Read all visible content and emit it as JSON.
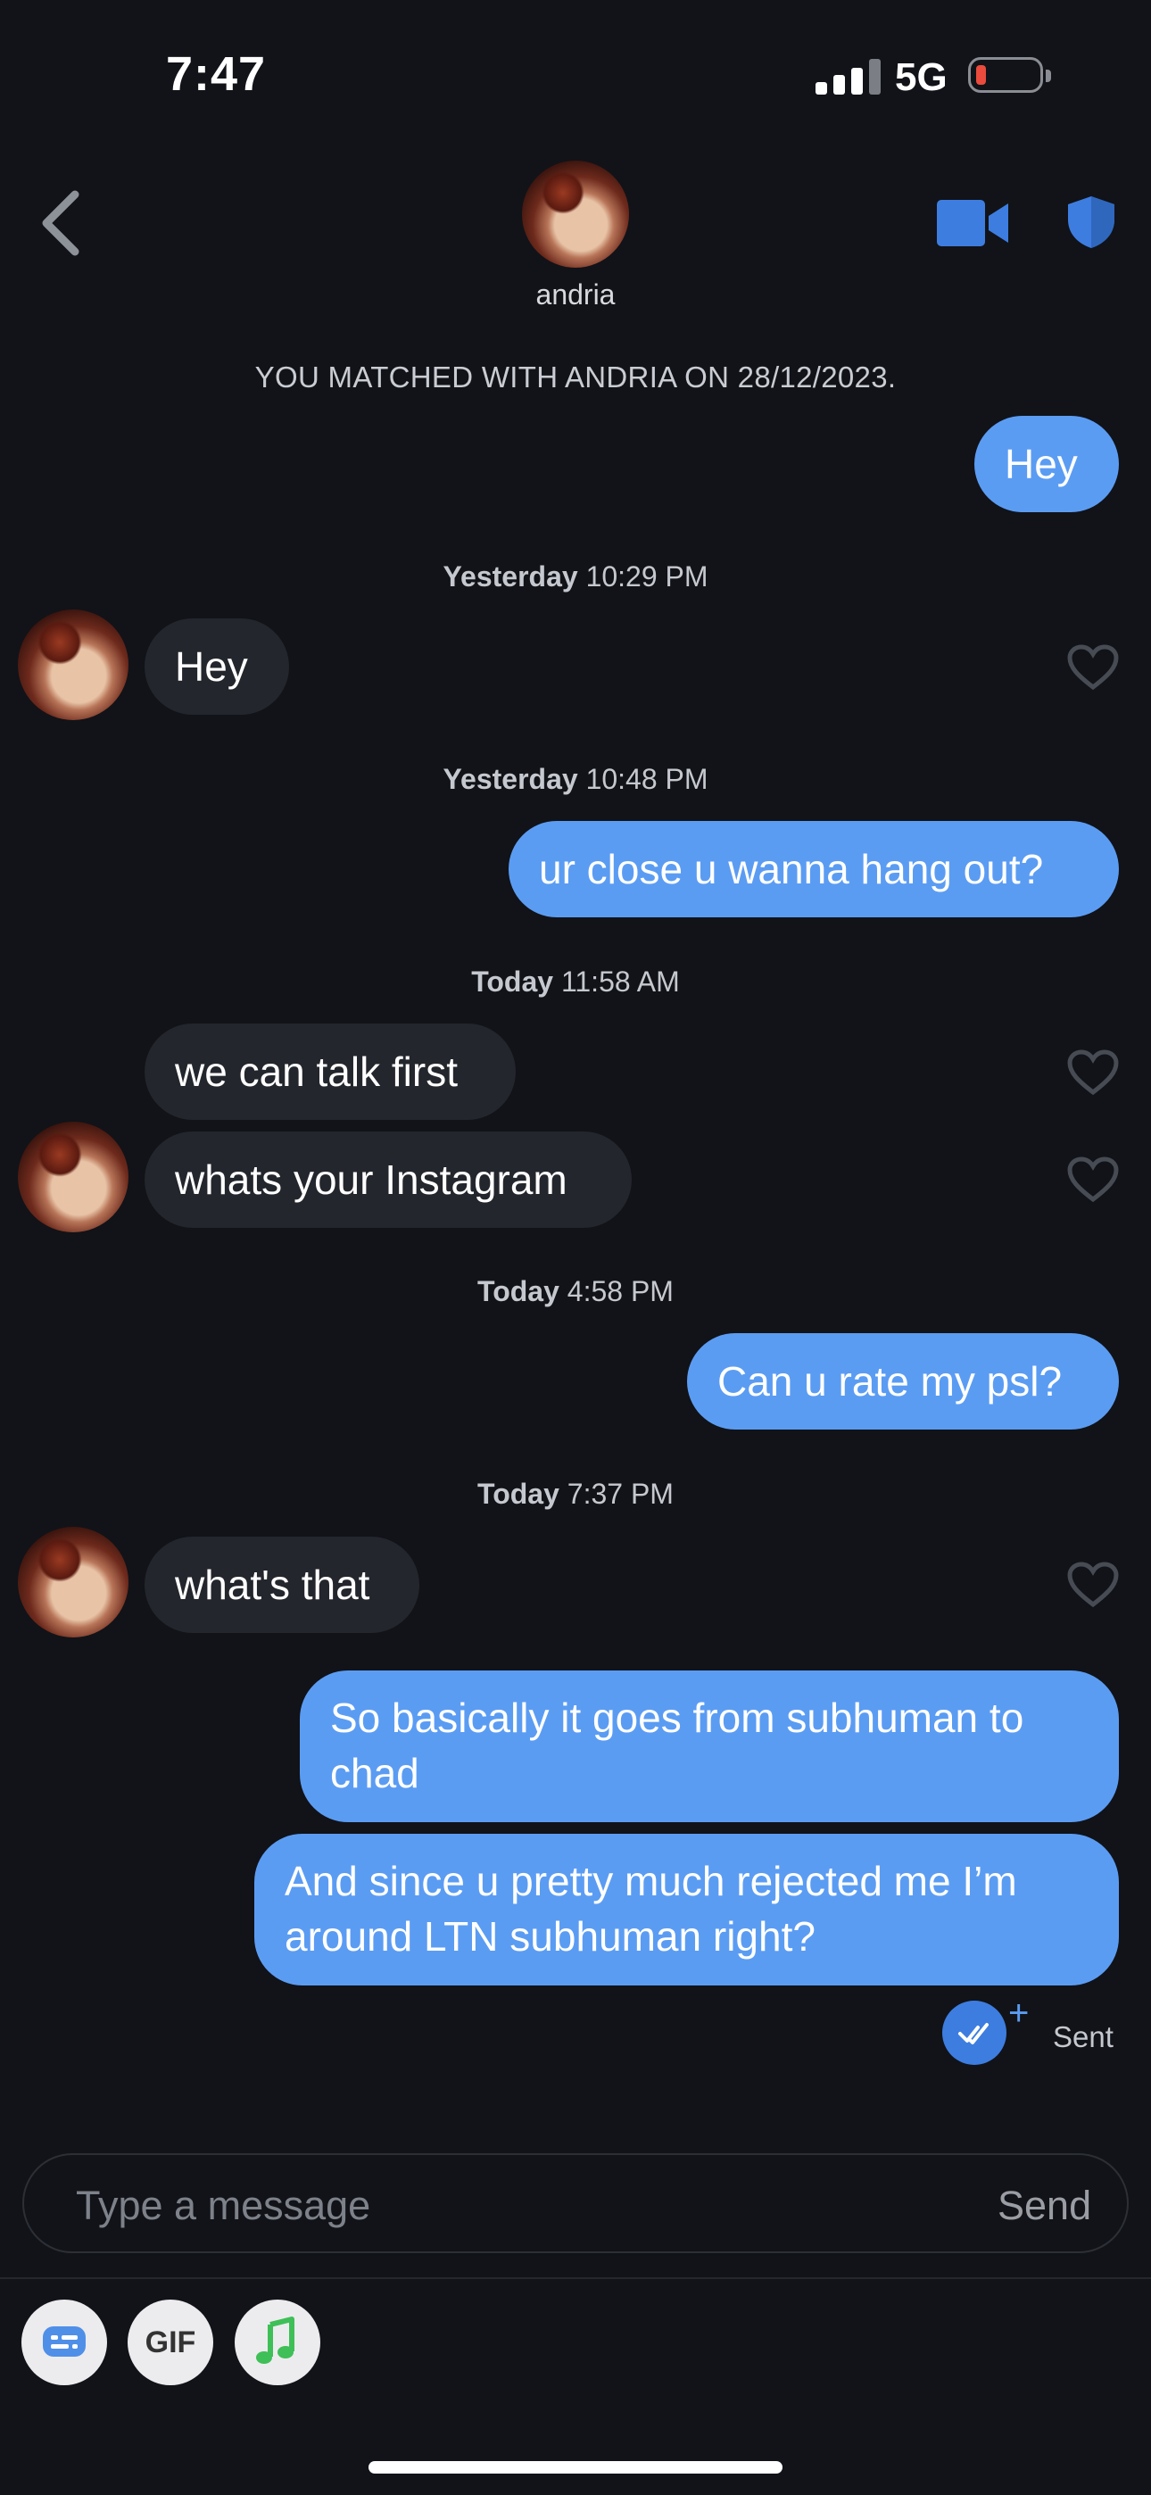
{
  "status_bar": {
    "time": "7:47",
    "network": "5G"
  },
  "header": {
    "name": "andria"
  },
  "match_notice": "YOU MATCHED WITH ANDRIA ON 28/12/2023.",
  "messages": {
    "m1": "Hey",
    "ts1_day": "Yesterday",
    "ts1_time": "10:29 PM",
    "m2": "Hey",
    "ts2_day": "Yesterday",
    "ts2_time": "10:48 PM",
    "m3": "ur close u wanna hang out?",
    "ts3_day": "Today",
    "ts3_time": "11:58 AM",
    "m4": "we can talk first",
    "m5": "whats your Instagram",
    "ts4_day": "Today",
    "ts4_time": "4:58 PM",
    "m6": "Can u rate my psl?",
    "ts5_day": "Today",
    "ts5_time": "7:37 PM",
    "m7": "what's that",
    "m8": "So basically it goes from subhuman to chad",
    "m9": "And since u pretty much rejected me I’m around LTN subhuman right?"
  },
  "receipt": {
    "plus": "+",
    "status": "Sent"
  },
  "composer": {
    "placeholder": "Type a message",
    "send_label": "Send"
  },
  "toolbar": {
    "gif_label": "GIF"
  },
  "colors": {
    "accent": "#5b9cf3",
    "incoming": "#23262c",
    "background": "#111318"
  },
  "icons": [
    "back-chevron-icon",
    "video-call-icon",
    "shield-icon",
    "heart-icon",
    "read-check-icon",
    "sticker-icon",
    "gif-icon",
    "music-icon"
  ]
}
